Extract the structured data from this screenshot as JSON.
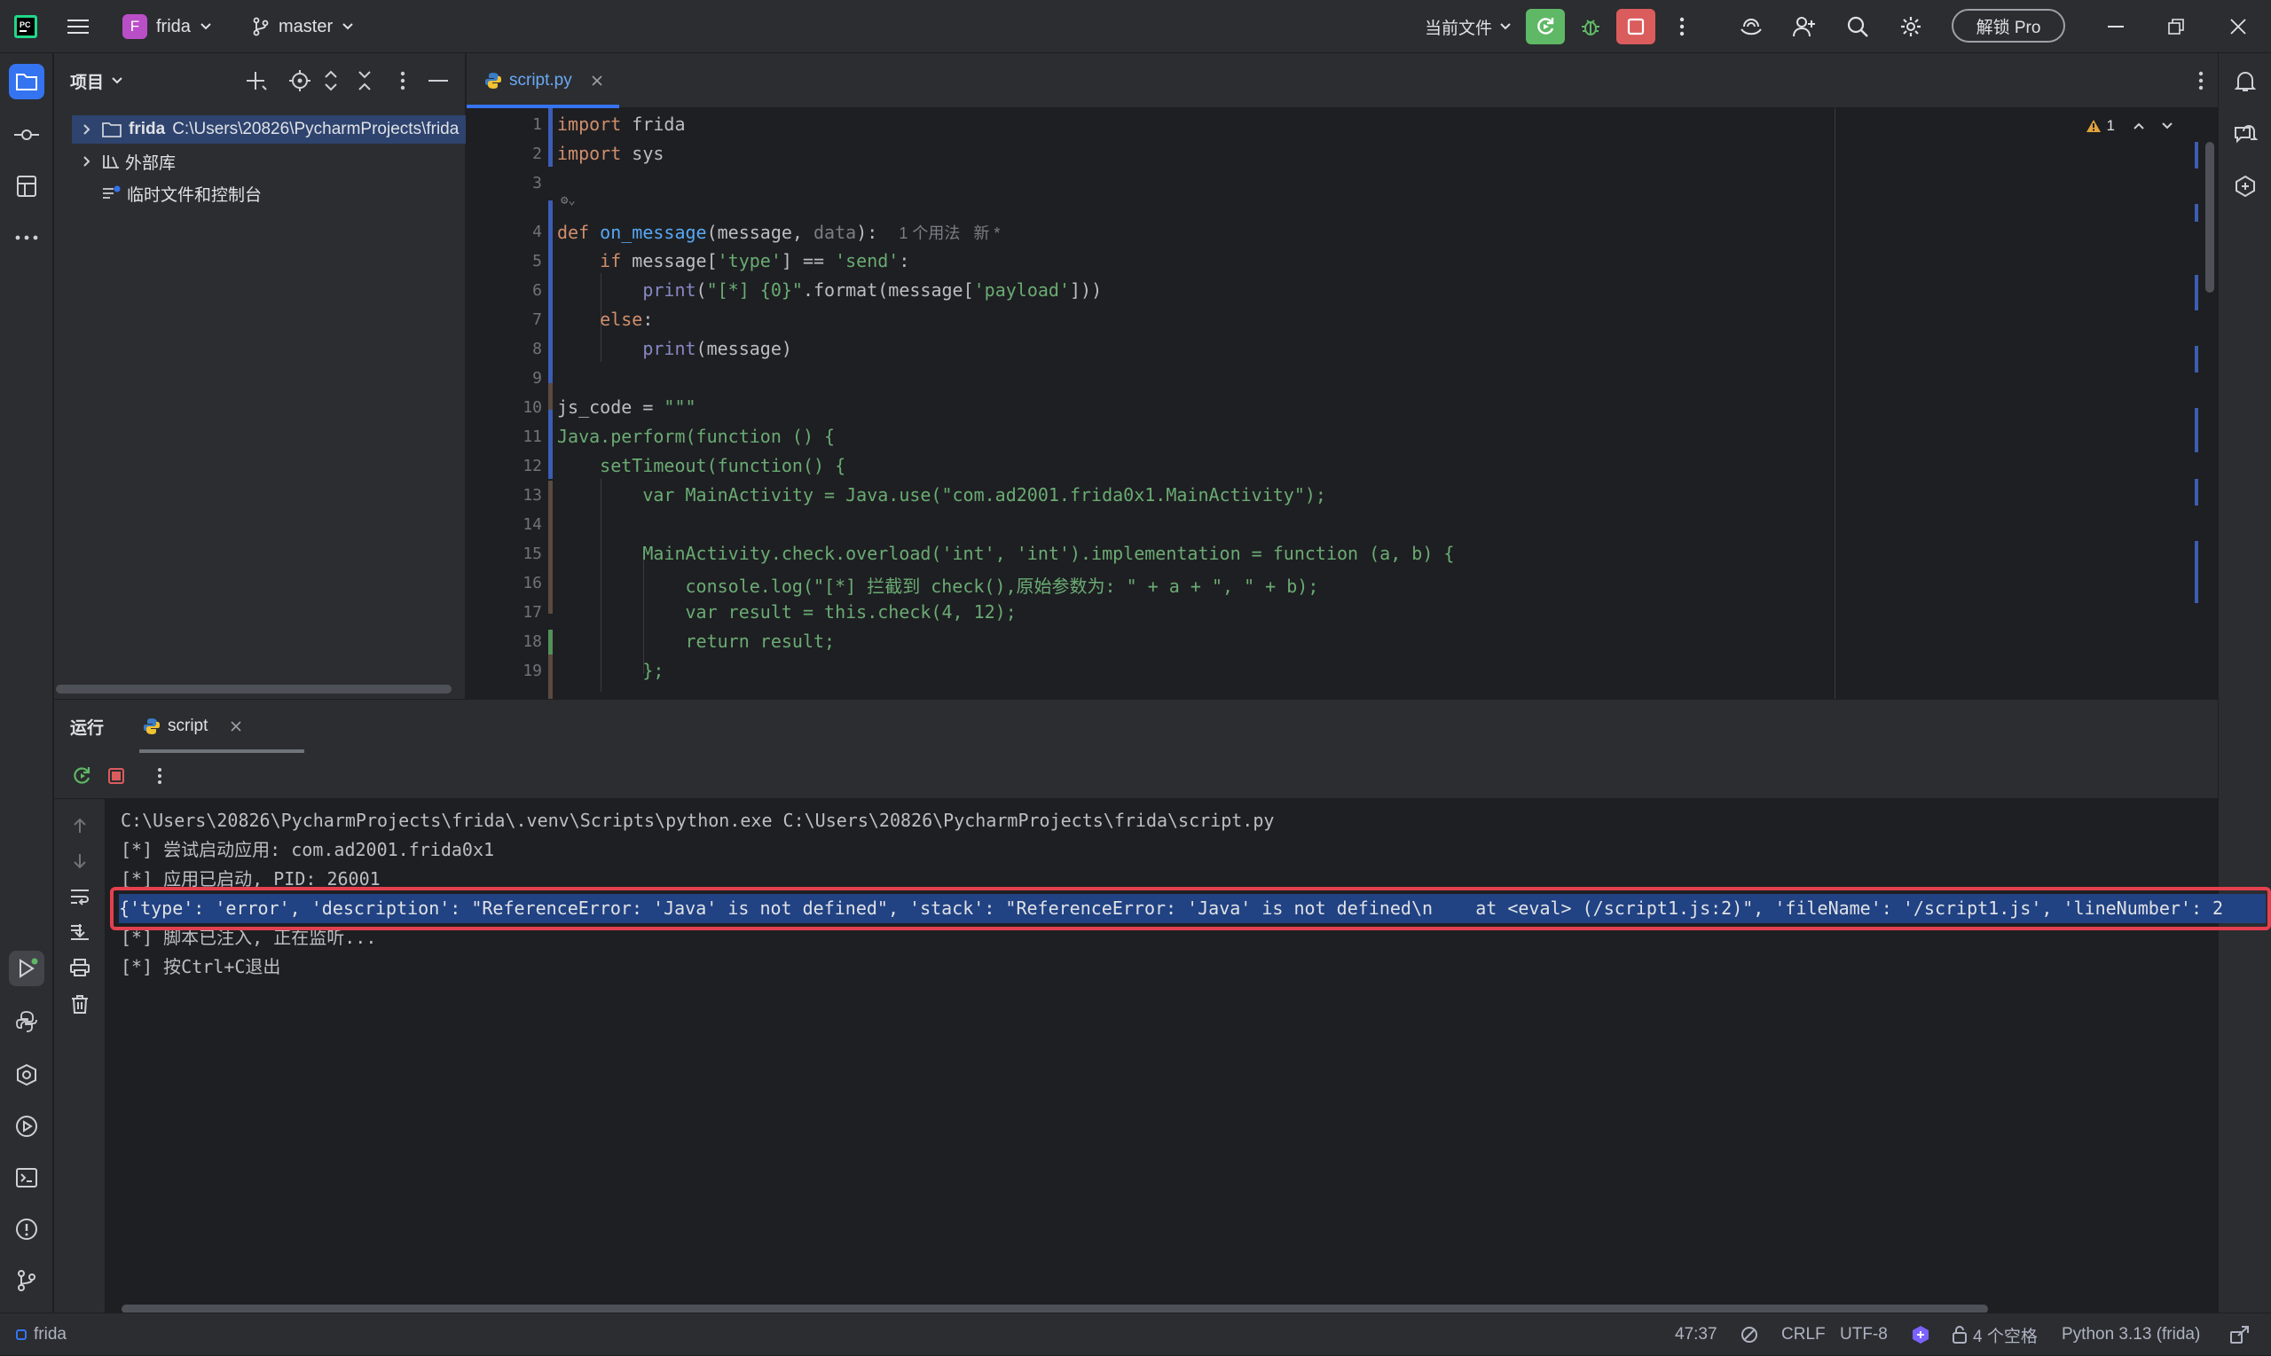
{
  "titlebar": {
    "project_initial": "F",
    "project_name": "frida",
    "branch": "master",
    "run_config": "当前文件",
    "unlock_label": "解锁 Pro"
  },
  "project_panel": {
    "title": "项目",
    "tree": [
      {
        "name": "frida",
        "path": "C:\\Users\\20826\\PycharmProjects\\frida"
      },
      {
        "name": "外部库"
      },
      {
        "name": "临时文件和控制台"
      }
    ]
  },
  "editor": {
    "tab_label": "script.py",
    "warning_count": "1",
    "lines": [
      {
        "n": "1",
        "t": "import frida"
      },
      {
        "n": "2",
        "t": "import sys"
      },
      {
        "n": "3",
        "t": ""
      },
      {
        "n": "4",
        "t": "def on_message(message, data):",
        "hint": "1 个用法   新 *"
      },
      {
        "n": "5",
        "t": "    if message['type'] == 'send':"
      },
      {
        "n": "6",
        "t": "        print(\"[*] {0}\".format(message['payload']))"
      },
      {
        "n": "7",
        "t": "    else:"
      },
      {
        "n": "8",
        "t": "        print(message)"
      },
      {
        "n": "9",
        "t": ""
      },
      {
        "n": "10",
        "t": "js_code = \"\"\""
      },
      {
        "n": "11",
        "t": "Java.perform(function () {"
      },
      {
        "n": "12",
        "t": "    setTimeout(function() {"
      },
      {
        "n": "13",
        "t": "        var MainActivity = Java.use(\"com.ad2001.frida0x1.MainActivity\");"
      },
      {
        "n": "14",
        "t": ""
      },
      {
        "n": "15",
        "t": "        MainActivity.check.overload('int', 'int').implementation = function (a, b) {"
      },
      {
        "n": "16",
        "t": "            console.log(\"[*] 拦截到 check(),原始参数为: \" + a + \", \" + b);"
      },
      {
        "n": "17",
        "t": "            var result = this.check(4, 12);"
      },
      {
        "n": "18",
        "t": "            return result;"
      },
      {
        "n": "19",
        "t": "        };"
      }
    ]
  },
  "run_panel": {
    "title": "运行",
    "tab_label": "script",
    "output": [
      "C:\\Users\\20826\\PycharmProjects\\frida\\.venv\\Scripts\\python.exe C:\\Users\\20826\\PycharmProjects\\frida\\script.py",
      "[*] 尝试启动应用: com.ad2001.frida0x1",
      "[*] 应用已启动, PID: 26001",
      "{'type': 'error', 'description': \"ReferenceError: 'Java' is not defined\", 'stack': \"ReferenceError: 'Java' is not defined\\n    at <eval> (/script1.js:2)\", 'fileName': '/script1.js', 'lineNumber': 2",
      "[*] 脚本已注入, 正在监听...",
      "[*] 按Ctrl+C退出"
    ],
    "highlighted_line": 3
  },
  "statusbar": {
    "project": "frida",
    "position": "47:37",
    "line_sep": "CRLF",
    "encoding": "UTF-8",
    "indent": "4 个空格",
    "interpreter": "Python 3.13 (frida)"
  },
  "colors": {
    "accent": "#3574f0",
    "run_green": "#5fb865",
    "stop_red": "#db5c5c",
    "highlight_box": "#e5404f"
  }
}
